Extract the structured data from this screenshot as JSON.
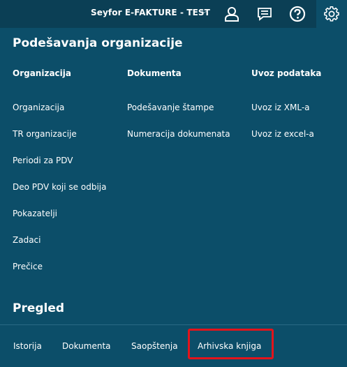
{
  "header": {
    "org_name": "Seyfor E-FAKTURE - TEST",
    "icons": [
      "user-icon",
      "messages-icon",
      "help-icon",
      "settings-icon"
    ]
  },
  "page_title": "Podešavanja organizacije",
  "columns": [
    {
      "header": "Organizacija",
      "items": [
        "Organizacija",
        "TR organizacije",
        "Periodi za PDV",
        "Deo PDV koji se odbija",
        "Pokazatelji",
        "Zadaci",
        "Prečice"
      ]
    },
    {
      "header": "Dokumenta",
      "items": [
        "Podešavanje štampe",
        "Numeracija dokumenata"
      ]
    },
    {
      "header": "Uvoz podataka",
      "items": [
        "Uvoz iz XML-a",
        "Uvoz iz excel-a"
      ]
    }
  ],
  "overview": {
    "title": "Pregled",
    "links": [
      "Istorija",
      "Dokumenta",
      "Saopštenja",
      "Arhivska knjiga"
    ]
  },
  "colors": {
    "background": "#0c4e69",
    "topbar": "#0b3f55",
    "highlight": "#e3141b"
  }
}
